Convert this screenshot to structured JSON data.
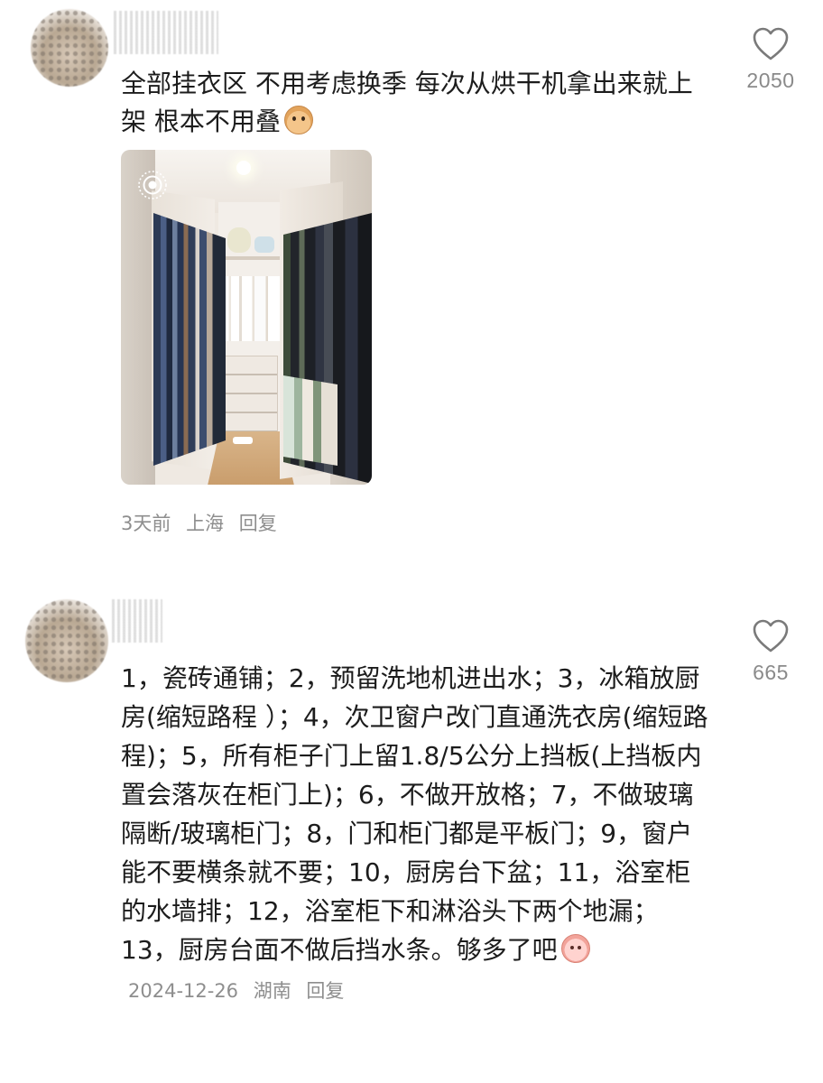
{
  "comments": [
    {
      "text": "全部挂衣区 不用考虑换季 每次从烘干机拿出来就上架 根本不用叠",
      "emoji": "dog-face-emoji",
      "likes": "2050",
      "meta": {
        "time": "3天前",
        "location": "上海",
        "reply": "回复"
      },
      "image": "walk-in-closet-photo"
    },
    {
      "text": "1，瓷砖通铺；2，预留洗地机进出水；3，冰箱放厨房(缩短路程 ）；4，次卫窗户改门直通洗衣房(缩短路程)；5，所有柜子门上留1.8/5公分上挡板(上挡板内置会落灰在柜门上)；6，不做开放格；7，不做玻璃隔断/玻璃柜门；8，门和柜门都是平板门；9，窗户能不要横条就不要；10，厨房台下盆；11，浴室柜的水墙排；12，浴室柜下和淋浴头下两个地漏；13，厨房台面不做后挡水条。够多了吧",
      "emoji": "peach-face-emoji",
      "likes": "665",
      "meta": {
        "time": "2024-12-26",
        "location": "湖南",
        "reply": "回复"
      }
    }
  ],
  "colors": {
    "text": "#1c1c1c",
    "meta": "#8e8e8e",
    "likes": "#8a8a8a",
    "heart_stroke": "#7a7a7a"
  },
  "icons": {
    "like": "heart-outline-icon",
    "live_photo": "live-photo-icon"
  }
}
